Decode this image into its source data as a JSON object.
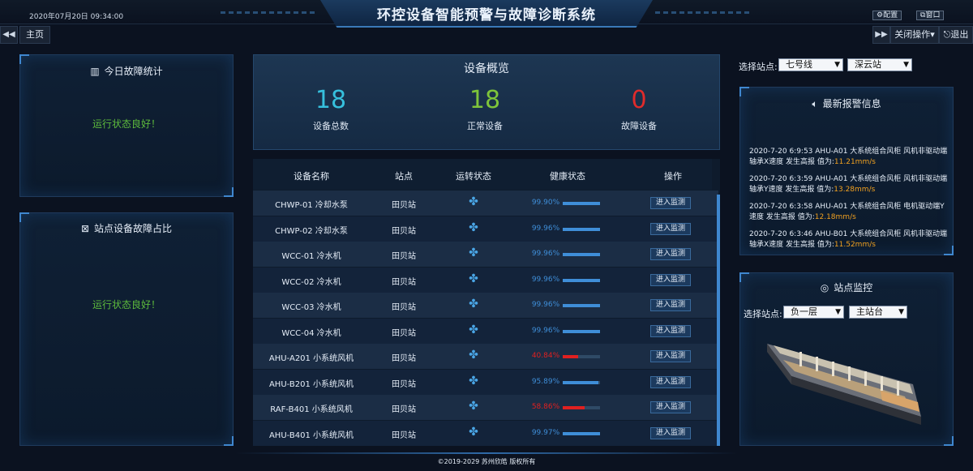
{
  "header": {
    "title": "环控设备智能预警与故障诊断系统",
    "datetime": "2020年07月20日 09:34:00",
    "config_label": "配置",
    "window_label": "窗口"
  },
  "nav": {
    "home_label": "主页",
    "close_ops_label": "关闭操作",
    "exit_label": "退出"
  },
  "left": {
    "fault_stats_title": "今日故障统计",
    "fault_stats_status": "运行状态良好！",
    "ratio_title": "站点设备故障占比",
    "ratio_status": "运行状态良好！"
  },
  "overview": {
    "title": "设备概览",
    "total": {
      "value": "18",
      "label": "设备总数",
      "color": "#36c0dd"
    },
    "normal": {
      "value": "18",
      "label": "正常设备",
      "color": "#7ec43a"
    },
    "fault": {
      "value": "0",
      "label": "故障设备",
      "color": "#e02b2b"
    }
  },
  "table": {
    "headers": [
      "设备名称",
      "站点",
      "运转状态",
      "健康状态",
      "操作"
    ],
    "rows": [
      {
        "name": "CHWP-01 冷却水泵",
        "site": "田贝站",
        "health": "99.90%",
        "level": 0.999,
        "warn": false,
        "action": "进入监测"
      },
      {
        "name": "CHWP-02 冷却水泵",
        "site": "田贝站",
        "health": "99.96%",
        "level": 0.9996,
        "warn": false,
        "action": "进入监测"
      },
      {
        "name": "WCC-01 冷水机",
        "site": "田贝站",
        "health": "99.96%",
        "level": 0.9996,
        "warn": false,
        "action": "进入监测"
      },
      {
        "name": "WCC-02 冷水机",
        "site": "田贝站",
        "health": "99.96%",
        "level": 0.9996,
        "warn": false,
        "action": "进入监测"
      },
      {
        "name": "WCC-03 冷水机",
        "site": "田贝站",
        "health": "99.96%",
        "level": 0.9996,
        "warn": false,
        "action": "进入监测"
      },
      {
        "name": "WCC-04 冷水机",
        "site": "田贝站",
        "health": "99.96%",
        "level": 0.9996,
        "warn": false,
        "action": "进入监测"
      },
      {
        "name": "AHU-A201 小系统风机",
        "site": "田贝站",
        "health": "40.84%",
        "level": 0.4084,
        "warn": true,
        "action": "进入监测"
      },
      {
        "name": "AHU-B201 小系统风机",
        "site": "田贝站",
        "health": "95.89%",
        "level": 0.9589,
        "warn": false,
        "action": "进入监测"
      },
      {
        "name": "RAF-B401 小系统风机",
        "site": "田贝站",
        "health": "58.86%",
        "level": 0.5886,
        "warn": true,
        "action": "进入监测"
      },
      {
        "name": "AHU-B401 小系统风机",
        "site": "田贝站",
        "health": "99.97%",
        "level": 0.9997,
        "warn": false,
        "action": "进入监测"
      }
    ]
  },
  "right": {
    "select_station_label": "选择站点:",
    "line_value": "七号线",
    "station_value": "深云站",
    "alarm_title": "最新报警信息",
    "alarms": [
      {
        "text": "2020-7-20 6:9:53 AHU-A01 大系统组合风柜 风机非驱动端轴承X速度 发生高报 值为:",
        "value": "11.21mm/s"
      },
      {
        "text": "2020-7-20 6:3:59 AHU-A01 大系统组合风柜 风机非驱动端轴承Y速度 发生高报 值为:",
        "value": "13.28mm/s"
      },
      {
        "text": "2020-7-20 6:3:58 AHU-A01 大系统组合风柜 电机驱动端Y速度 发生高报 值为:",
        "value": "12.18mm/s"
      },
      {
        "text": "2020-7-20 6:3:46 AHU-B01 大系统组合风柜 风机非驱动端轴承X速度 发生高报 值为:",
        "value": "11.52mm/s"
      }
    ],
    "monitor_title": "站点监控",
    "monitor_select_label": "选择站点:",
    "floor_value": "负一层",
    "platform_value": "主站台"
  },
  "footer": {
    "copyright": "©2019-2029  苏州欣皓  版权所有"
  },
  "colors": {
    "good": "#5dbb3c",
    "bar_ok": "#3f8ed8",
    "bar_warn": "#e02020",
    "pct_ok": "#3f8ed8",
    "pct_warn": "#e02020",
    "fan_icon": "#4aa6e6"
  }
}
